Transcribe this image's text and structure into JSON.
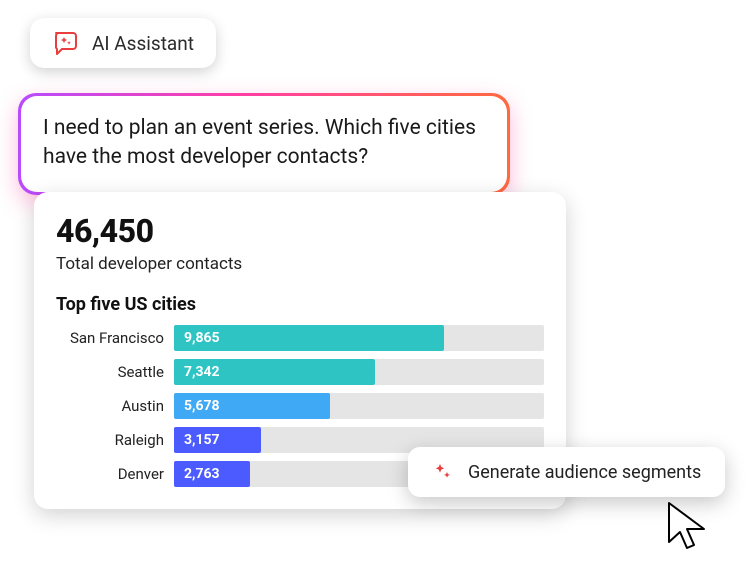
{
  "ai_assistant": {
    "label": "AI Assistant",
    "icon_color": "#e83e3e"
  },
  "prompt": {
    "text": "I need to plan an event series. Which five cities have the most developer contacts?"
  },
  "result": {
    "metric_value": "46,450",
    "metric_label": "Total developer contacts",
    "chart_title": "Top five US cities"
  },
  "chart_data": {
    "type": "bar",
    "title": "Top five US cities",
    "xlabel": "",
    "ylabel": "",
    "categories": [
      "San Francisco",
      "Seattle",
      "Austin",
      "Raleigh",
      "Denver"
    ],
    "values": [
      9865,
      7342,
      5678,
      3157,
      2763
    ],
    "value_labels": [
      "9,865",
      "7,342",
      "5,678",
      "3,157",
      "2,763"
    ],
    "colors": [
      "#2ec4c4",
      "#2ec4c4",
      "#3fa9f5",
      "#4b5bff",
      "#4b5bff"
    ],
    "max_track": 13500
  },
  "action": {
    "label": "Generate audience segments",
    "icon_color": "#e83e3e"
  }
}
